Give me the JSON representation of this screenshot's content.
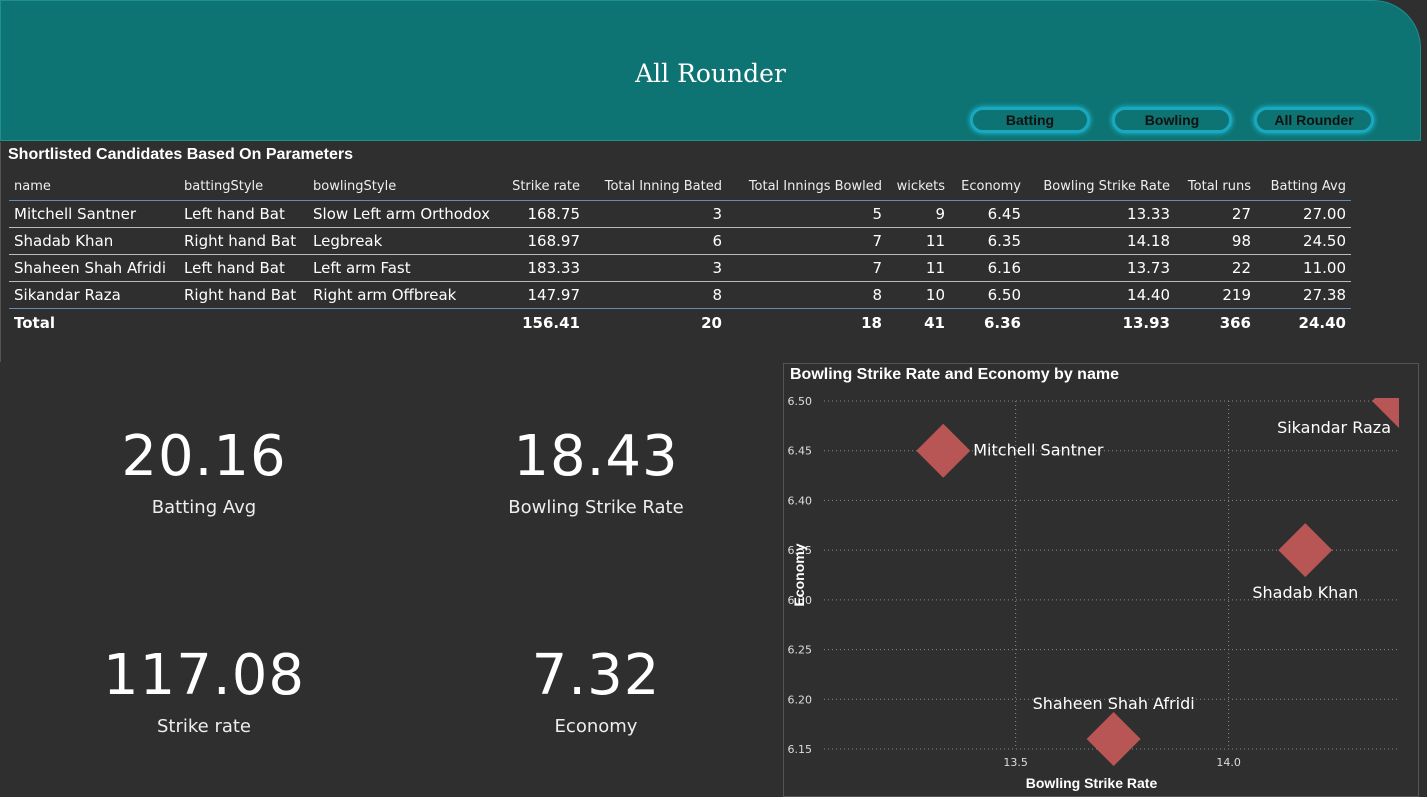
{
  "header": {
    "title": "All Rounder",
    "buttons": [
      "Batting",
      "Bowling",
      "All Rounder"
    ]
  },
  "table": {
    "title": "Shortlisted Candidates Based On Parameters",
    "columns": [
      "name",
      "battingStyle",
      "bowlingStyle",
      "Strike rate",
      "Total Inning Bated",
      "Total Innings Bowled",
      "wickets",
      "Economy",
      "Bowling Strike Rate",
      "Total runs",
      "Batting Avg"
    ],
    "rows": [
      [
        "Mitchell Santner",
        "Left hand Bat",
        "Slow Left arm Orthodox",
        "168.75",
        "3",
        "5",
        "9",
        "6.45",
        "13.33",
        "27",
        "27.00"
      ],
      [
        "Shadab Khan",
        "Right hand Bat",
        "Legbreak",
        "168.97",
        "6",
        "7",
        "11",
        "6.35",
        "14.18",
        "98",
        "24.50"
      ],
      [
        "Shaheen Shah Afridi",
        "Left hand Bat",
        "Left arm Fast",
        "183.33",
        "3",
        "7",
        "11",
        "6.16",
        "13.73",
        "22",
        "11.00"
      ],
      [
        "Sikandar Raza",
        "Right hand Bat",
        "Right arm Offbreak",
        "147.97",
        "8",
        "8",
        "10",
        "6.50",
        "14.40",
        "219",
        "27.38"
      ]
    ],
    "total": [
      "Total",
      "",
      "",
      "156.41",
      "20",
      "18",
      "41",
      "6.36",
      "13.93",
      "366",
      "24.40"
    ]
  },
  "cards": [
    {
      "value": "20.16",
      "label": "Batting Avg"
    },
    {
      "value": "18.43",
      "label": "Bowling Strike Rate"
    },
    {
      "value": "117.08",
      "label": "Strike rate"
    },
    {
      "value": "7.32",
      "label": "Economy"
    }
  ],
  "chart_data": {
    "type": "scatter",
    "title": "Bowling Strike Rate and Economy by name",
    "xlabel": "Bowling Strike Rate",
    "ylabel": "Economy",
    "xlim": [
      13.05,
      14.4
    ],
    "ylim": [
      6.15,
      6.5
    ],
    "xticks": [
      "13.5",
      "14.0"
    ],
    "yticks": [
      "6.15",
      "6.20",
      "6.25",
      "6.30",
      "6.35",
      "6.40",
      "6.45",
      "6.50"
    ],
    "grid": true,
    "marker_color": "#b85555",
    "points": [
      {
        "name": "Mitchell Santner",
        "x": 13.33,
        "y": 6.45
      },
      {
        "name": "Shadab Khan",
        "x": 14.18,
        "y": 6.35
      },
      {
        "name": "Shaheen Shah Afridi",
        "x": 13.73,
        "y": 6.16
      },
      {
        "name": "Sikandar Raza",
        "x": 14.4,
        "y": 6.5
      }
    ]
  }
}
